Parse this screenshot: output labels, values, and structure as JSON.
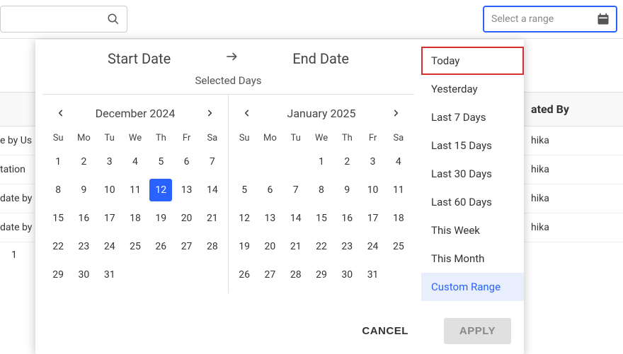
{
  "topbar": {
    "range_placeholder": "Select a range"
  },
  "table": {
    "header_created_by": "ated By",
    "rows": [
      {
        "c1": "e by Us",
        "c2": "hika"
      },
      {
        "c1": "tation",
        "c2": "hika"
      },
      {
        "c1": "date by",
        "c2": "hika"
      },
      {
        "c1": "date by",
        "c2": "hika"
      }
    ],
    "page": "1"
  },
  "picker": {
    "tabs": {
      "start": "Start Date",
      "end": "End Date"
    },
    "selected_days_label": "Selected Days",
    "dow": [
      "Su",
      "Mo",
      "Tu",
      "We",
      "Th",
      "Fr",
      "Sa"
    ],
    "cal_left": {
      "title": "December 2024",
      "lead": 0,
      "days": 31,
      "selected": 12
    },
    "cal_right": {
      "title": "January 2025",
      "lead": 3,
      "days": 31,
      "selected": null
    },
    "presets": [
      "Today",
      "Yesterday",
      "Last 7 Days",
      "Last 15 Days",
      "Last 30 Days",
      "Last 60 Days",
      "This Week",
      "This Month",
      "Custom Range"
    ],
    "highlighted_preset": 0,
    "active_preset": 8,
    "actions": {
      "cancel": "CANCEL",
      "apply": "APPLY"
    }
  }
}
